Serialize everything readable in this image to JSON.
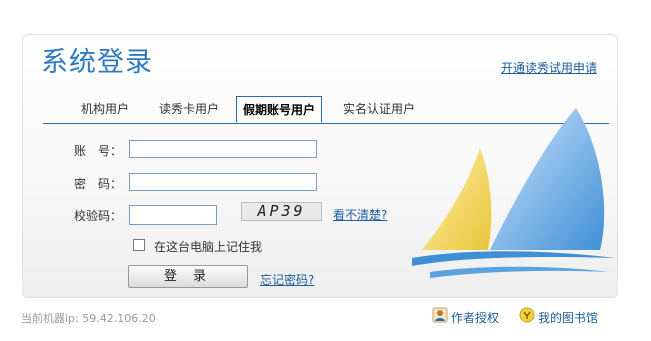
{
  "header": {
    "title": "系统登录",
    "apply_link": "开通读秀试用申请"
  },
  "tabs": [
    {
      "label": "机构用户"
    },
    {
      "label": "读秀卡用户"
    },
    {
      "label": "假期账号用户",
      "active": true
    },
    {
      "label": "实名认证用户"
    }
  ],
  "form": {
    "account_label": "账　号：",
    "account_value": "",
    "password_label": "密　码：",
    "password_value": "",
    "captcha_label": "校验码：",
    "captcha_value": "",
    "captcha_text": "AP39",
    "captcha_refresh": "看不清楚?",
    "remember_label": "在这台电脑上记住我",
    "remember_checked": false,
    "login_button": "登 录",
    "forgot_link": "忘记密码?"
  },
  "footer": {
    "ip_text": "当前机器ip:  59.42.106.20",
    "author_auth": "作者授权",
    "my_library": "我的图书馆"
  },
  "colors": {
    "title_blue": "#2f79c0",
    "link_blue": "#1d5d9c",
    "tab_border": "#2a6aa6",
    "sail_yellow": "#f2d24b",
    "sail_blue": "#3f8fd6"
  },
  "icons": [
    "person-icon",
    "yellow-round-icon",
    "sailboat-logo"
  ]
}
